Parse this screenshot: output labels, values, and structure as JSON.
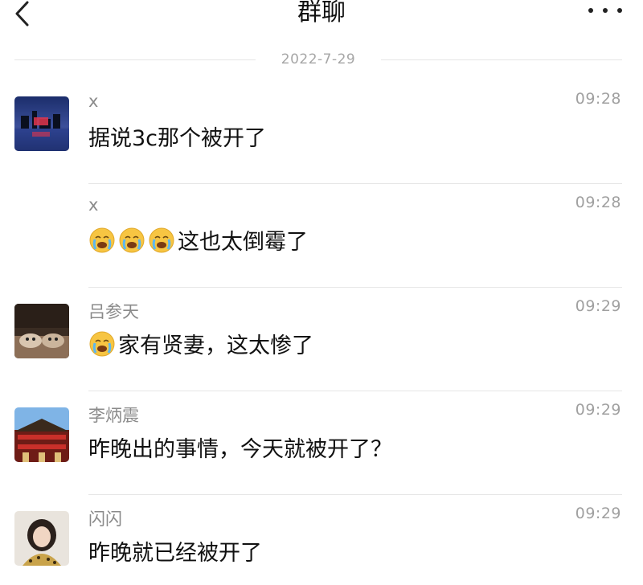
{
  "header": {
    "title": "群聊",
    "back_icon": "chevron-left-icon",
    "more_icon": "more-horizontal-icon"
  },
  "date_separator": "2022-7-29",
  "emoji_name": "loudly-crying-face-icon",
  "messages": [
    {
      "sender": "x",
      "time": "09:28",
      "text": "据说3c那个被开了",
      "emoji_count": 0
    },
    {
      "sender": "x",
      "time": "09:28",
      "text": "这也太倒霉了",
      "emoji_count": 3
    },
    {
      "sender": "吕参天",
      "time": "09:29",
      "text": "家有贤妻，这太惨了",
      "emoji_count": 1
    },
    {
      "sender": "李炳震",
      "time": "09:29",
      "text": "昨晚出的事情，今天就被开了？",
      "emoji_count": 0
    },
    {
      "sender": "闪闪",
      "time": "09:29",
      "text": "昨晚就已经被开了",
      "emoji_count": 0
    }
  ],
  "colors": {
    "text": "#111111",
    "secondary_text": "#8a8a8a",
    "divider": "#e6e6e6",
    "emoji_face": "#f7c542"
  }
}
